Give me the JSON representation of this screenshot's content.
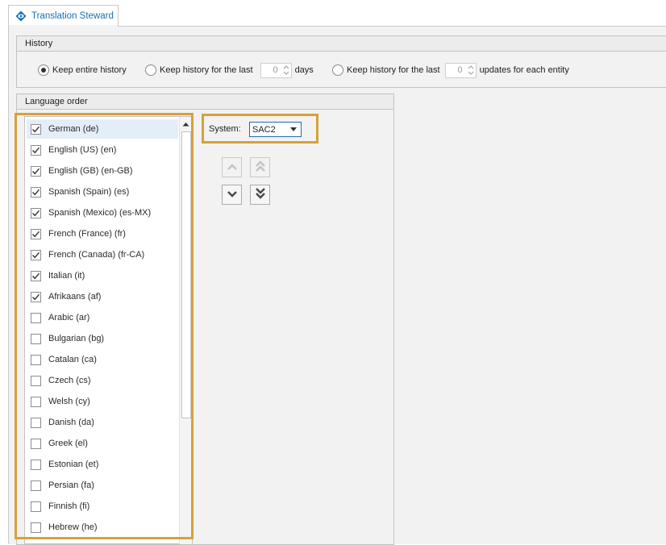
{
  "tab": {
    "label": "Translation Steward",
    "icon": "diamond-eye-icon",
    "accent": "#1b6fb5"
  },
  "history": {
    "header": "History",
    "options": [
      {
        "label": "Keep entire history",
        "checked": true
      },
      {
        "label": "Keep history for the last",
        "checked": false,
        "value": "0",
        "suffix": "days"
      },
      {
        "label": "Keep history for the last",
        "checked": false,
        "value": "0",
        "suffix": "updates for each entity"
      }
    ]
  },
  "language_order": {
    "header": "Language order",
    "items": [
      {
        "label": "German (de)",
        "checked": true,
        "selected": true
      },
      {
        "label": "English (US) (en)",
        "checked": true
      },
      {
        "label": "English (GB) (en-GB)",
        "checked": true
      },
      {
        "label": "Spanish (Spain) (es)",
        "checked": true
      },
      {
        "label": "Spanish (Mexico) (es-MX)",
        "checked": true
      },
      {
        "label": "French (France) (fr)",
        "checked": true
      },
      {
        "label": "French (Canada) (fr-CA)",
        "checked": true
      },
      {
        "label": "Italian (it)",
        "checked": true
      },
      {
        "label": "Afrikaans (af)",
        "checked": true
      },
      {
        "label": "Arabic (ar)",
        "checked": false
      },
      {
        "label": "Bulgarian (bg)",
        "checked": false
      },
      {
        "label": "Catalan (ca)",
        "checked": false
      },
      {
        "label": "Czech (cs)",
        "checked": false
      },
      {
        "label": "Welsh (cy)",
        "checked": false
      },
      {
        "label": "Danish (da)",
        "checked": false
      },
      {
        "label": "Greek (el)",
        "checked": false
      },
      {
        "label": "Estonian (et)",
        "checked": false
      },
      {
        "label": "Persian (fa)",
        "checked": false
      },
      {
        "label": "Finnish (fi)",
        "checked": false
      },
      {
        "label": "Hebrew (he)",
        "checked": false
      }
    ]
  },
  "system": {
    "label": "System:",
    "value": "SAC2"
  },
  "colors": {
    "highlight": "#d6a13c",
    "selection": "#e4eef9"
  }
}
